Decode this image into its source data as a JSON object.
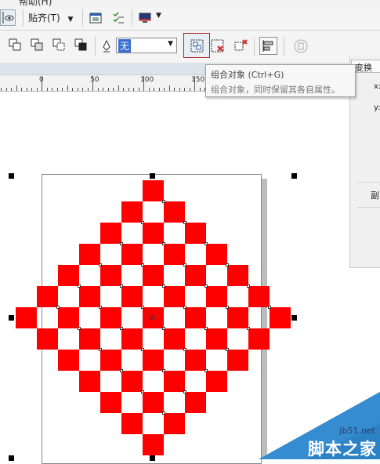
{
  "menu": {
    "fragment": "帮助(H)"
  },
  "toolbar": {
    "paste_label": "贴齐(T)"
  },
  "property_bar": {
    "outline_value": "无"
  },
  "ruler": {
    "labels": [
      "0",
      "50",
      "100",
      "150"
    ]
  },
  "tooltip": {
    "title": "组合对象 (Ctrl+G)",
    "description": "组合对象，同时保留其各自属性。"
  },
  "docker": {
    "tab_label": "变换",
    "x_label": "x:",
    "y_label": "y:",
    "copy_label": "副"
  },
  "canvas": {
    "shape_color": "#ff0000",
    "pattern": "diamond checkerboard"
  },
  "watermark": {
    "url": "jb51.net",
    "name": "脚本之家"
  },
  "colors": {
    "toolbar_bg": "#f4f4f4",
    "accent_red": "#ff0000",
    "active_border": "#b22222"
  }
}
